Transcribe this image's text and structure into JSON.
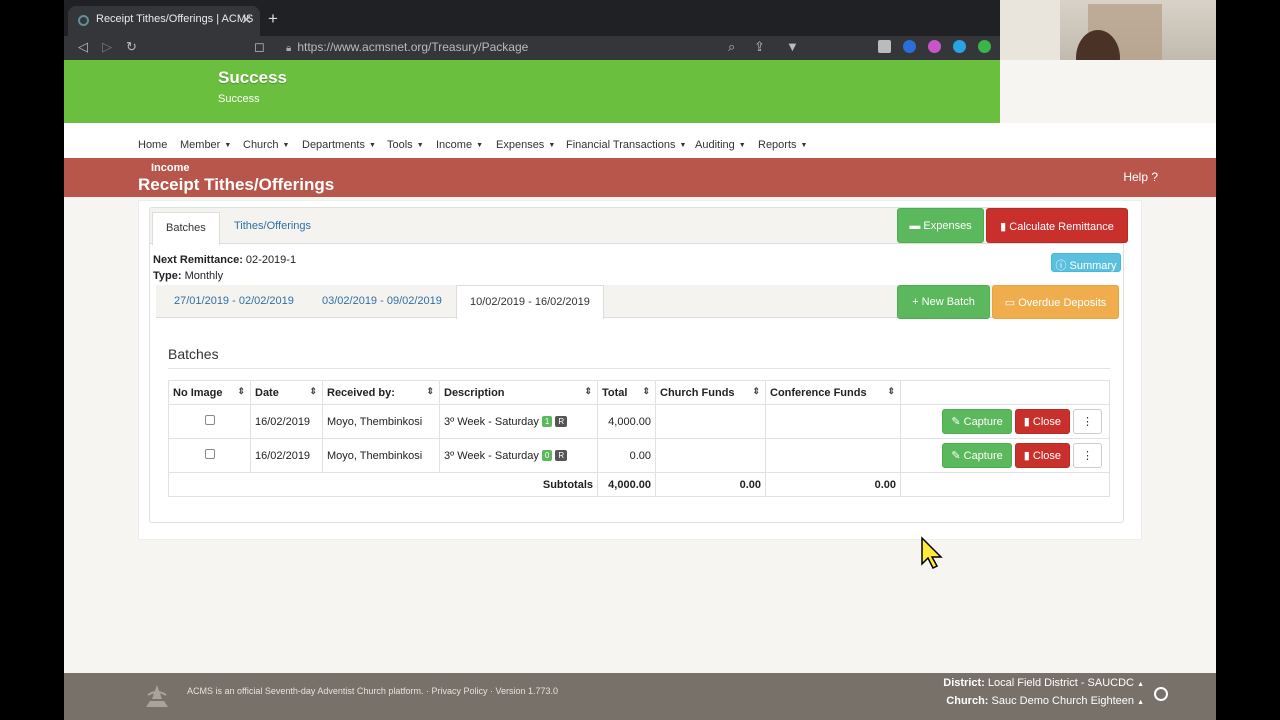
{
  "browser": {
    "tab_title": "Receipt Tithes/Offerings | ACMS",
    "tab_close": "✕",
    "new_tab": "+",
    "url": "https://www.acmsnet.org/Treasury/Package"
  },
  "alert": {
    "title": "Success",
    "message": "Success"
  },
  "nav": {
    "items": [
      "Home",
      "Member",
      "Church",
      "Departments",
      "Tools",
      "Income",
      "Expenses",
      "Financial Transactions",
      "Auditing",
      "Reports"
    ],
    "dropdown_marker": "▼"
  },
  "banner": {
    "section": "Income",
    "title": "Receipt Tithes/Offerings",
    "help": "Help ?"
  },
  "top_tabs": {
    "batches": "Batches",
    "tithes": "Tithes/Offerings"
  },
  "actions": {
    "expenses": "Expenses",
    "calculate": "Calculate Remittance",
    "summary": "Summary",
    "new_batch": "New Batch",
    "overdue": "Overdue Deposits"
  },
  "info": {
    "next_remittance_label": "Next Remittance:",
    "next_remittance_value": "02-2019-1",
    "type_label": "Type:",
    "type_value": "Monthly"
  },
  "periods": [
    "27/01/2019 - 02/02/2019",
    "03/02/2019 - 09/02/2019",
    "10/02/2019 - 16/02/2019"
  ],
  "batches": {
    "heading": "Batches",
    "columns": [
      "No Image",
      "Date",
      "Received by:",
      "Description",
      "Total",
      "Church Funds",
      "Conference Funds",
      ""
    ],
    "rows": [
      {
        "date": "16/02/2019",
        "received_by": "Moyo, Thembinkosi",
        "description": "3º Week - Saturday",
        "badge_count": "1",
        "badge_r": "R",
        "total": "4,000.00",
        "church_funds": "",
        "conference_funds": "",
        "capture": "Capture",
        "close": "Close",
        "more": "⋮"
      },
      {
        "date": "16/02/2019",
        "received_by": "Moyo, Thembinkosi",
        "description": "3º Week - Saturday",
        "badge_count": "0",
        "badge_r": "R",
        "total": "0.00",
        "church_funds": "",
        "conference_funds": "",
        "capture": "Capture",
        "close": "Close",
        "more": "⋮"
      }
    ],
    "subtotals_label": "Subtotals",
    "subtotal_total": "4,000.00",
    "subtotal_church": "0.00",
    "subtotal_conference": "0.00"
  },
  "footer": {
    "text": "ACMS is an official Seventh-day Adventist Church platform.  ·  Privacy Policy  ·  Version 1.773.0",
    "district_label": "District:",
    "district_value": "Local Field District - SAUCDC",
    "church_label": "Church:",
    "church_value": "Sauc Demo Church Eighteen"
  },
  "colors": {
    "success": "#6bbf3e",
    "banner": "#b9564c",
    "green": "#5cb85c",
    "red": "#c9302c",
    "orange": "#f0ad4e",
    "info": "#5bc0de"
  }
}
